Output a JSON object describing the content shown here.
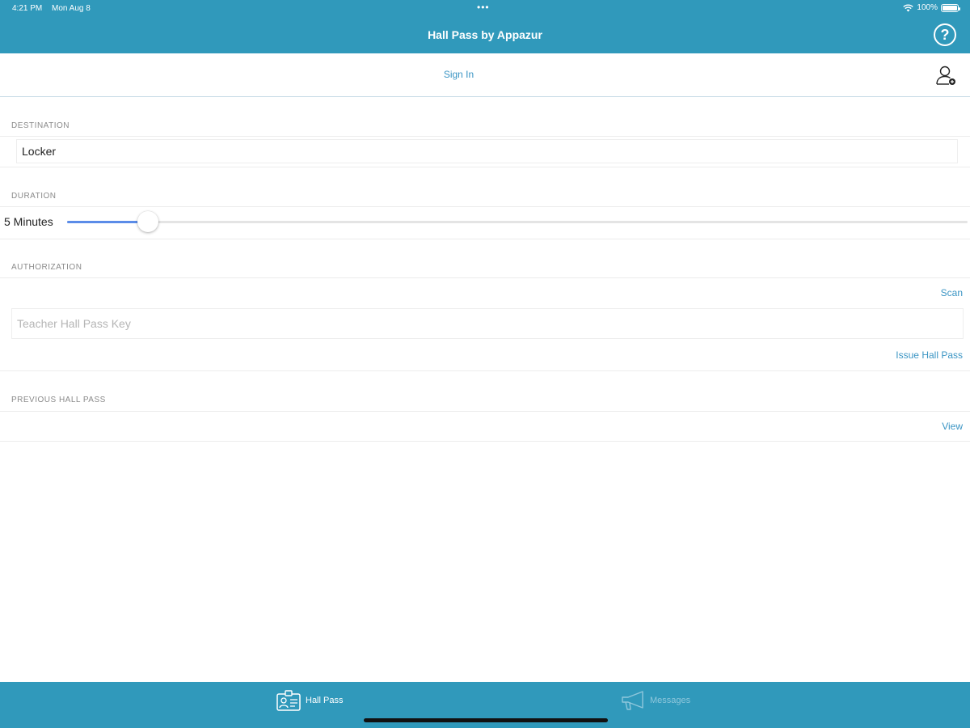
{
  "status_bar": {
    "time": "4:21 PM",
    "date": "Mon Aug 8",
    "dots": "•••",
    "battery": "100%"
  },
  "nav": {
    "title": "Hall Pass by Appazur",
    "help_icon": "help-circle-icon",
    "help_glyph": "?"
  },
  "signin": {
    "label": "Sign In",
    "icon": "user-add-icon"
  },
  "destination": {
    "label": "DESTINATION",
    "value": "Locker"
  },
  "duration": {
    "label": "DURATION",
    "value_text": "5 Minutes",
    "slider_fraction": 0.09
  },
  "authorization": {
    "label": "AUTHORIZATION",
    "scan_label": "Scan",
    "key_placeholder": "Teacher Hall Pass Key",
    "issue_label": "Issue Hall Pass"
  },
  "previous": {
    "label": "PREVIOUS HALL PASS",
    "view_label": "View"
  },
  "tabs": [
    {
      "label": "Hall Pass",
      "icon": "id-card-icon",
      "active": true
    },
    {
      "label": "Messages",
      "icon": "megaphone-icon",
      "active": false
    }
  ],
  "colors": {
    "brand": "#3099bb",
    "link": "#3b95c4",
    "slider_fill": "#5b8ce8",
    "tab_inactive": "#8fc7dc"
  }
}
